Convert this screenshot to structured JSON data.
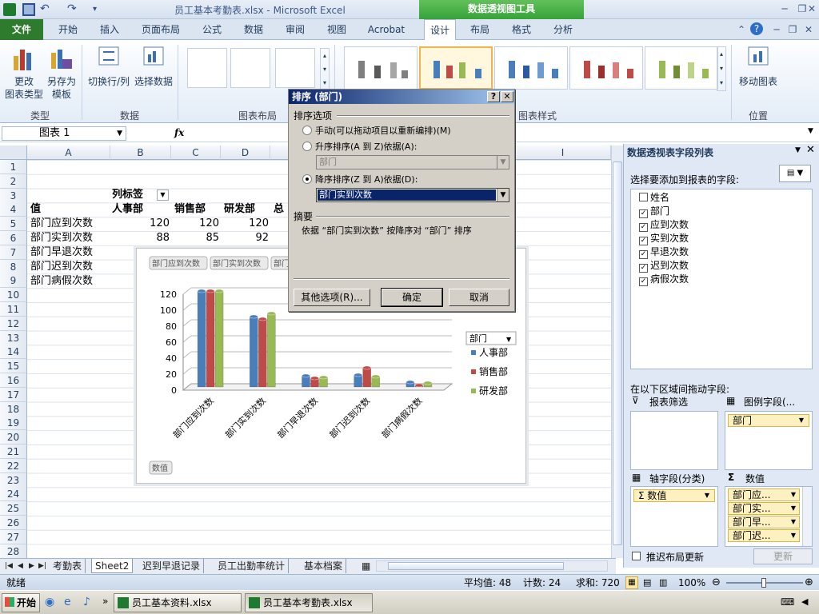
{
  "window": {
    "title": "员工基本考勤表.xlsx  -  Microsoft Excel",
    "context_tab_group": "数据透视图工具"
  },
  "tabs": [
    "文件",
    "开始",
    "插入",
    "页面布局",
    "公式",
    "数据",
    "审阅",
    "视图",
    "Acrobat",
    "设计",
    "布局",
    "格式",
    "分析"
  ],
  "ribbon": {
    "type_group": {
      "label": "类型",
      "change_chart_type": "更改\n图表类型",
      "save_as_template": "另存为\n模板"
    },
    "data_group": {
      "label": "数据",
      "switch_row_col": "切换行/列",
      "select_data": "选择数据"
    },
    "layout_group": {
      "label": "图表布局"
    },
    "style_group": {
      "label": "图表样式"
    },
    "location_group": {
      "label": "位置",
      "move_chart": "移动图表"
    }
  },
  "formula_bar": {
    "name_box": "图表  1",
    "fx": "fx",
    "value": ""
  },
  "columns": [
    "A",
    "B",
    "C",
    "D",
    "I"
  ],
  "rows": [
    "1",
    "2",
    "3",
    "4",
    "5",
    "6",
    "7",
    "8",
    "9",
    "10",
    "11",
    "12",
    "13",
    "14",
    "15",
    "16",
    "17",
    "18",
    "19",
    "20",
    "21",
    "22",
    "23",
    "24",
    "25",
    "26",
    "27",
    "28"
  ],
  "sheet": {
    "col_label_header": "列标签",
    "value_header": "值",
    "dept_headers": [
      "人事部",
      "销售部",
      "研发部",
      "总"
    ],
    "row_labels": [
      "部门应到次数",
      "部门实到次数",
      "部门早退次数",
      "部门迟到次数",
      "部门病假次数"
    ],
    "row5_values": [
      "120",
      "120",
      "120"
    ],
    "row6_values": [
      "88",
      "85",
      "92"
    ]
  },
  "chart_data": {
    "type": "bar",
    "categories": [
      "部门应到次数",
      "部门实到次数",
      "部门早退次数",
      "部门迟到次数",
      "部门病假次数"
    ],
    "series": [
      {
        "name": "人事部",
        "values": [
          120,
          88,
          14,
          15,
          6
        ],
        "color": "#4a7ebb"
      },
      {
        "name": "销售部",
        "values": [
          120,
          85,
          11,
          24,
          2
        ],
        "color": "#be4b48"
      },
      {
        "name": "研发部",
        "values": [
          120,
          92,
          12,
          13,
          5
        ],
        "color": "#98b954"
      }
    ],
    "yticks": [
      "0",
      "20",
      "40",
      "60",
      "80",
      "100",
      "120"
    ],
    "ylim": [
      0,
      120
    ],
    "legend_title": "部门",
    "legend_placement": "right",
    "field_buttons": [
      "部门应到次数",
      "部门实到次数",
      "部门"
    ],
    "value_button": "数值",
    "grid": true
  },
  "sort_dialog": {
    "title": "排序 (部门)",
    "section_options": "排序选项",
    "manual": "手动(可以拖动项目以重新编排)(M)",
    "ascending": "升序排序(A 到 Z)依据(A):",
    "ascending_value": "部门",
    "descending": "降序排序(Z 到 A)依据(D):",
    "descending_value": "部门实到次数",
    "section_summary": "摘要",
    "summary_text": "依据 “部门实到次数” 按降序对 “部门” 排序",
    "more_options": "其他选项(R)...",
    "ok": "确定",
    "cancel": "取消"
  },
  "pivot_panel": {
    "title": "数据透视表字段列表",
    "choose_label": "选择要添加到报表的字段:",
    "fields": [
      {
        "name": "姓名",
        "checked": false
      },
      {
        "name": "部门",
        "checked": true
      },
      {
        "name": "应到次数",
        "checked": true
      },
      {
        "name": "实到次数",
        "checked": true
      },
      {
        "name": "早退次数",
        "checked": true
      },
      {
        "name": "迟到次数",
        "checked": true
      },
      {
        "name": "病假次数",
        "checked": true
      }
    ],
    "drag_label": "在以下区域间拖动字段:",
    "report_filter": "报表筛选",
    "legend_fields": "图例字段(...",
    "legend_item": "部门",
    "axis_fields": "轴字段(分类)",
    "axis_item": "Σ 数值",
    "values": "数值",
    "value_items": [
      "部门应...",
      "部门实...",
      "部门早...",
      "部门迟..."
    ],
    "defer_update": "推迟布局更新",
    "update_button": "更新"
  },
  "sheet_tabs": [
    "考勤表",
    "Sheet2",
    "迟到早退记录",
    "员工出勤率统计",
    "基本档案"
  ],
  "status": {
    "ready": "就绪",
    "average": "平均值: 48",
    "count": "计数: 24",
    "sum": "求和: 720",
    "zoom": "100%"
  },
  "taskbar": {
    "start": "开始",
    "items": [
      "员工基本资料.xlsx",
      "员工基本考勤表.xlsx"
    ]
  }
}
